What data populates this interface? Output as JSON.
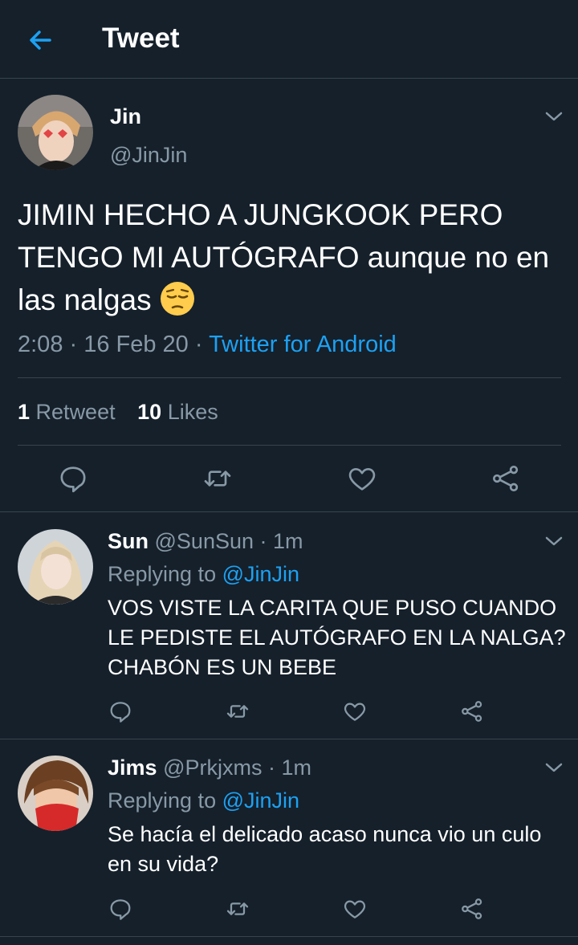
{
  "header": {
    "title": "Tweet"
  },
  "tweet": {
    "author_name": "Jin",
    "author_handle": "@JinJin",
    "text": "JIMIN HECHO A JUNGKOOK PERO TENGO MI AUTÓGRAFO aunque no en las nalgas",
    "emoji": "pensive-face",
    "time": "2:08 · 16 Feb 20 · ",
    "source": "Twitter for Android",
    "retweets_count": "1",
    "retweets_label": "Retweet",
    "likes_count": "10",
    "likes_label": "Likes"
  },
  "replies": [
    {
      "name": "Sun",
      "handle": "@SunSun",
      "time": "· 1m",
      "replying_prefix": "Replying to ",
      "replying_to": "@JinJin",
      "text": "VOS VISTE LA CARITA QUE PUSO CUANDO LE PEDISTE EL AUTÓGRAFO EN LA NALGA? CHABÓN ES UN BEBE"
    },
    {
      "name": "Jims",
      "handle": "@Prkjxms",
      "time": "· 1m",
      "replying_prefix": "Replying to ",
      "replying_to": "@JinJin",
      "text": "Se hacía el delicado acaso nunca vio un culo en su vida?"
    }
  ],
  "colors": {
    "background": "#15202b",
    "accent": "#1da1f2",
    "muted": "#8899a6",
    "border": "#38444d"
  },
  "icons": [
    "back-arrow-icon",
    "chevron-down-icon",
    "reply-icon",
    "retweet-icon",
    "like-icon",
    "share-icon"
  ]
}
